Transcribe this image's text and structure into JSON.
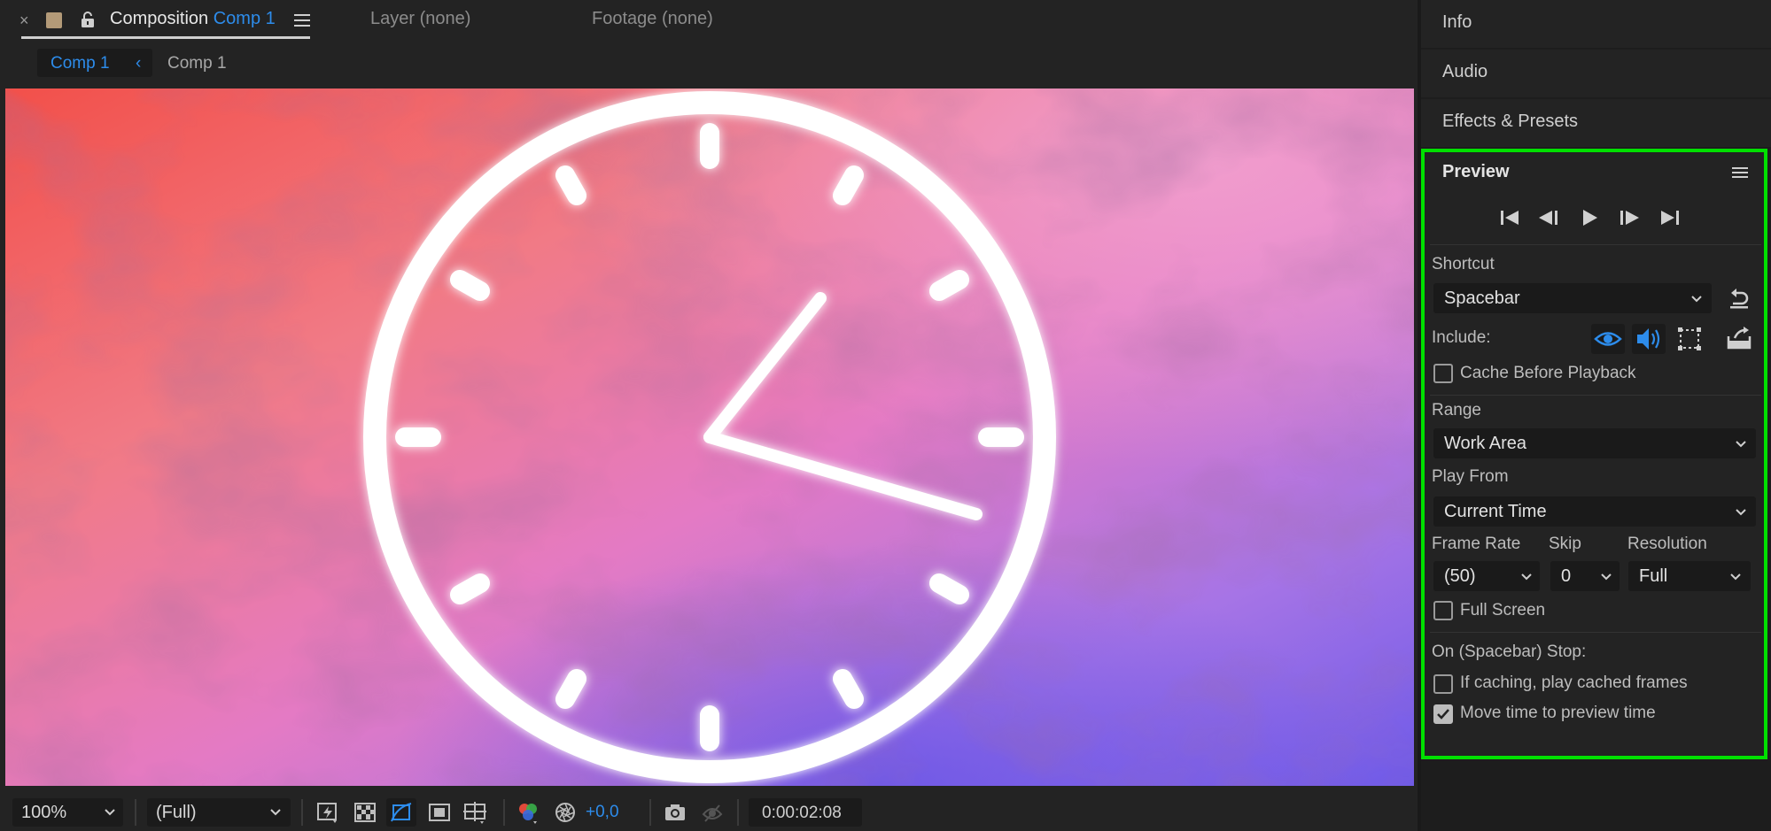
{
  "composition_panel": {
    "close": "×",
    "tab_composition_prefix": "Composition",
    "tab_composition_name": "Comp 1",
    "tab_layer": "Layer (none)",
    "tab_footage": "Footage (none)",
    "breadcrumb_active": "Comp 1",
    "breadcrumb_arrow": "‹",
    "breadcrumb_second": "Comp 1"
  },
  "viewer_toolbar": {
    "zoom": "100%",
    "resolution": "(Full)",
    "exposure": "+0,0",
    "timecode": "0:00:02:08"
  },
  "side_tabs": {
    "info": "Info",
    "audio": "Audio",
    "effects": "Effects & Presets"
  },
  "preview": {
    "title": "Preview",
    "shortcut_label": "Shortcut",
    "shortcut_value": "Spacebar",
    "include_label": "Include:",
    "cache_before_playback": "Cache Before Playback",
    "range_label": "Range",
    "range_value": "Work Area",
    "play_from_label": "Play From",
    "play_from_value": "Current Time",
    "frame_rate_label": "Frame Rate",
    "skip_label": "Skip",
    "resolution_label": "Resolution",
    "frame_rate_value": "(50)",
    "skip_value": "0",
    "resolution_value": "Full",
    "full_screen": "Full Screen",
    "on_stop_label": "On (Spacebar) Stop:",
    "if_caching": "If caching, play cached frames",
    "move_time": "Move time to preview time",
    "cache_before_playback_checked": false,
    "full_screen_checked": false,
    "if_caching_checked": false,
    "move_time_checked": true
  },
  "colors": {
    "accent_blue": "#2d8ceb",
    "highlight_green": "#00e000",
    "panel_bg": "#232323"
  }
}
